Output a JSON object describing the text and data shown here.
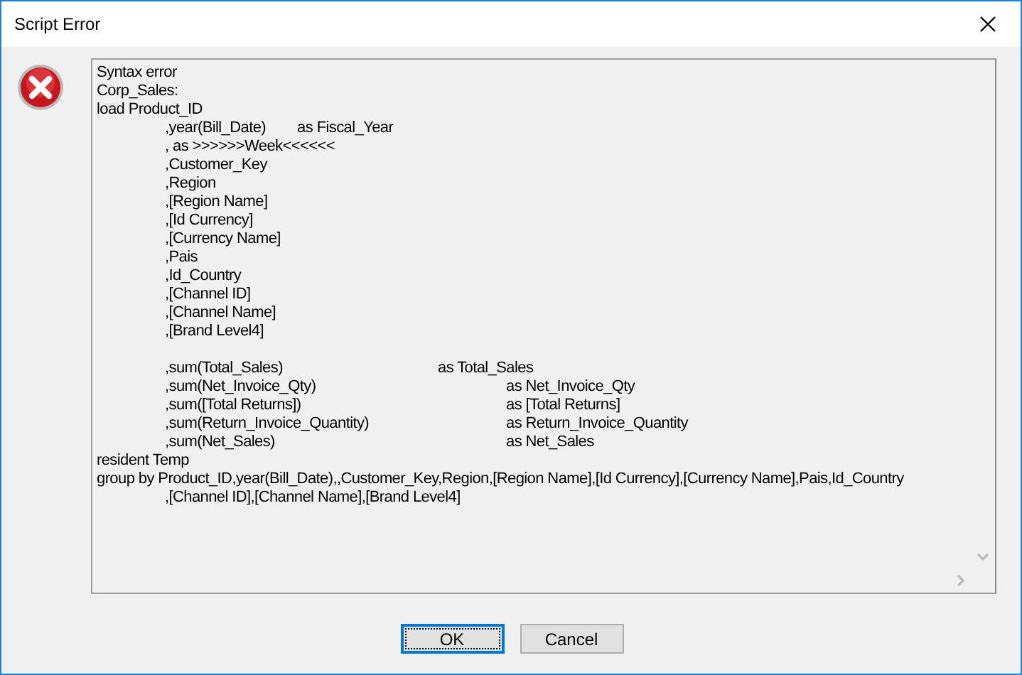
{
  "window": {
    "title": "Script Error"
  },
  "message": "Syntax error\nCorp_Sales:\nload Product_ID\n\t,year(Bill_Date)        as Fiscal_Year\n\t, as >>>>>>Week<<<<<<\n\t,Customer_Key\n\t,Region\n\t,[Region Name]\n\t,[Id Currency]\n\t,[Currency Name]\n\t,Pais\n\t,Id_Country\n\t,[Channel ID]\n\t,[Channel Name]\n\t,[Brand Level4]\n\n\t,sum(Total_Sales)\t\t\tas Total_Sales\n\t,sum(Net_Invoice_Qty)\t\t\tas Net_Invoice_Qty\n\t,sum([Total Returns])\t\t\tas [Total Returns]\n\t,sum(Return_Invoice_Quantity)\t\tas Return_Invoice_Quantity\n\t,sum(Net_Sales)\t\t\t\tas Net_Sales\nresident Temp\ngroup by Product_ID,year(Bill_Date),,Customer_Key,Region,[Region Name],[Id Currency],[Currency Name],Pais,Id_Country\n\t,[Channel ID],[Channel Name],[Brand Level4]",
  "buttons": [
    {
      "label": "OK",
      "default": true
    },
    {
      "label": "Cancel",
      "default": false
    }
  ]
}
